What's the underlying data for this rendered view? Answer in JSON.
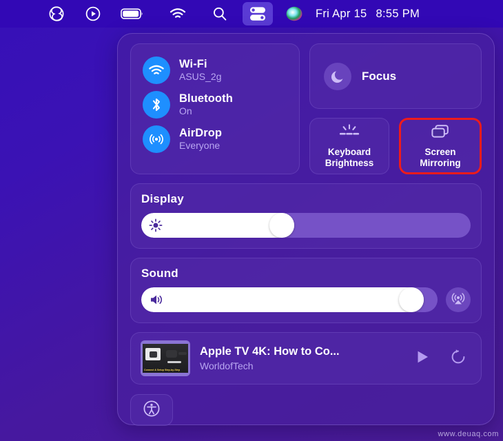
{
  "menubar": {
    "icons": [
      {
        "name": "creative-cloud-icon",
        "label": "Creative Cloud"
      },
      {
        "name": "play-circle-icon",
        "label": "Play"
      },
      {
        "name": "battery-icon",
        "label": "Battery"
      },
      {
        "name": "wifi-icon",
        "label": "Wi-Fi"
      },
      {
        "name": "search-icon",
        "label": "Spotlight Search"
      },
      {
        "name": "control-center-icon",
        "label": "Control Center"
      },
      {
        "name": "siri-icon",
        "label": "Siri"
      }
    ],
    "date": "Fri Apr 15",
    "time": "8:55 PM"
  },
  "control_center": {
    "connectivity": [
      {
        "icon": "wifi-icon",
        "title": "Wi-Fi",
        "subtitle": "ASUS_2g"
      },
      {
        "icon": "bluetooth-icon",
        "title": "Bluetooth",
        "subtitle": "On"
      },
      {
        "icon": "airdrop-icon",
        "title": "AirDrop",
        "subtitle": "Everyone"
      }
    ],
    "focus": {
      "icon": "moon-icon",
      "label": "Focus"
    },
    "tiles": [
      {
        "icon": "keyboard-brightness-icon",
        "line1": "Keyboard",
        "line2": "Brightness",
        "highlighted": false
      },
      {
        "icon": "screen-mirroring-icon",
        "line1": "Screen",
        "line2": "Mirroring",
        "highlighted": true
      }
    ],
    "display": {
      "title": "Display",
      "icon": "brightness-icon",
      "value": 42
    },
    "sound": {
      "title": "Sound",
      "icon": "speaker-icon",
      "value": 95,
      "airplay_icon": "airplay-icon"
    },
    "now_playing": {
      "title": "Apple TV 4K: How to Co...",
      "artist": "WorldofTech",
      "artwork_caption": "Connect & Setup Step-by-Step",
      "play_icon": "play-icon",
      "replay_icon": "replay-icon"
    },
    "accessibility": {
      "icon": "accessibility-icon",
      "label": "Accessibility"
    }
  },
  "colors": {
    "highlight": "#ef1b1b",
    "accent_blue": "#1e8fff",
    "menubar_bg": "#3208b5",
    "subtitle": "#b9a6f2"
  },
  "watermark": "www.deuaq.com"
}
